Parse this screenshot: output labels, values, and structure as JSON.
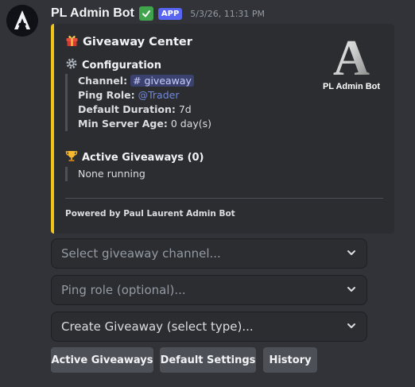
{
  "message": {
    "username": "PL Admin Bot",
    "app_badge": "APP",
    "timestamp": "5/3/26, 11:31 PM"
  },
  "embed": {
    "accent_color": "#f0c419",
    "title": "Giveaway Center",
    "title_icon": "gift-icon",
    "thumbnail": {
      "brand_letter": "A",
      "brand_text": "PL Admin Bot"
    },
    "configuration": {
      "title": "Configuration",
      "icon": "gear-icon",
      "channel_label": "Channel:",
      "channel_value": "# giveaway",
      "ping_role_label": "Ping Role:",
      "ping_role_value": "@Trader",
      "default_duration_label": "Default Duration:",
      "default_duration_value": "7d",
      "min_server_age_label": "Min Server Age:",
      "min_server_age_value": "0 day(s)"
    },
    "active": {
      "title": "Active Giveaways (0)",
      "icon": "trophy-icon",
      "status": "None running"
    },
    "footer": "Powered by Paul Laurent Admin Bot"
  },
  "selects": [
    {
      "placeholder": "Select giveaway channel..."
    },
    {
      "placeholder": "Ping role (optional)..."
    },
    {
      "value": "Create Giveaway (select type)..."
    }
  ],
  "buttons": [
    {
      "label": "Active Giveaways"
    },
    {
      "label": "Default Settings"
    },
    {
      "label": "History"
    }
  ]
}
